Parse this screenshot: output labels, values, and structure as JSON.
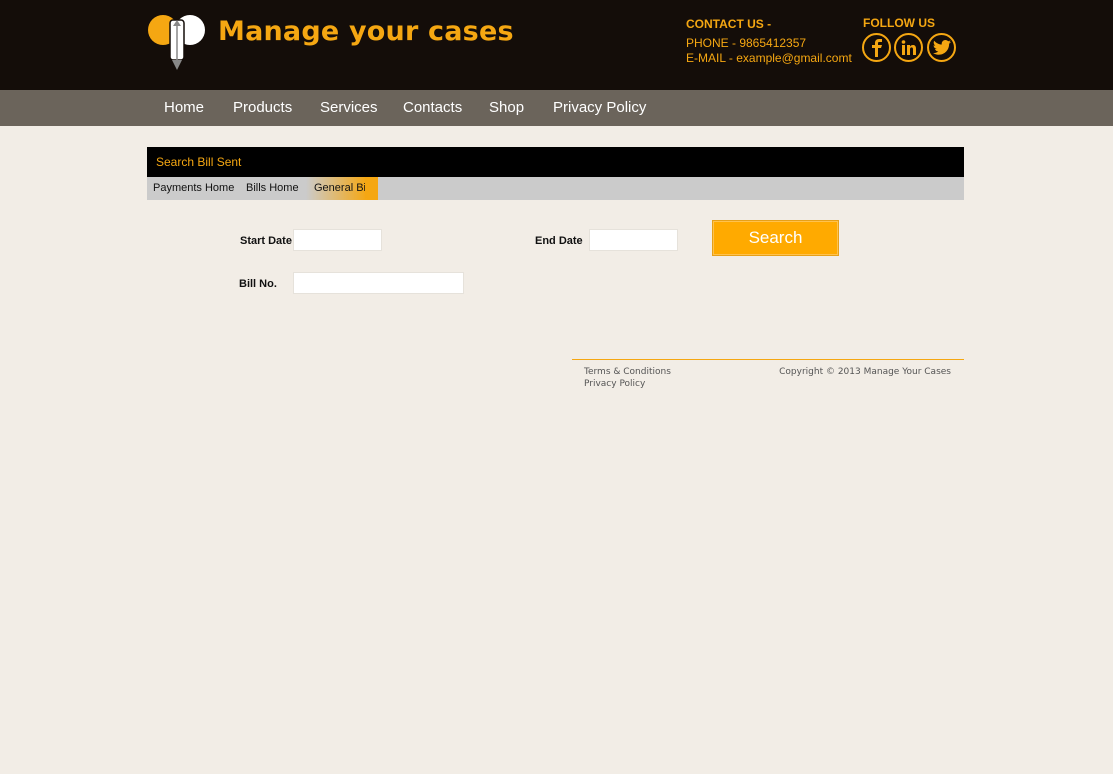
{
  "brand": {
    "title": "Manage your cases",
    "colors": {
      "accent": "#f5a712",
      "header_bg": "#140d09",
      "nav_bg": "#6b645b",
      "page_bg": "#f2ede6"
    },
    "logo_icon": "pen-nib-logo-icon"
  },
  "contact": {
    "heading": "CONTACT US -",
    "phone": "PHONE - 9865412357",
    "email": "E-MAIL - example@gmail.comt"
  },
  "follow": {
    "heading": "FOLLOW US",
    "icons": [
      "facebook-icon",
      "linkedin-icon",
      "twitter-icon"
    ]
  },
  "nav": {
    "items": [
      "Home",
      "Products",
      "Services",
      "Contacts",
      "Shop",
      "Privacy Policy"
    ]
  },
  "panel": {
    "title": "Search Bill Sent"
  },
  "breadcrumb": {
    "items": [
      "Payments Home",
      "Bills Home",
      "General Bill"
    ]
  },
  "form": {
    "start_date_label": "Start Date",
    "start_date_value": "",
    "end_date_label": "End Date",
    "end_date_value": "",
    "bill_no_label": "Bill No.",
    "bill_no_value": "",
    "search_label": "Search"
  },
  "footer": {
    "terms": "Terms & Conditions",
    "privacy": "Privacy Policy",
    "copyright": "Copyright © 2013 Manage Your Cases"
  }
}
